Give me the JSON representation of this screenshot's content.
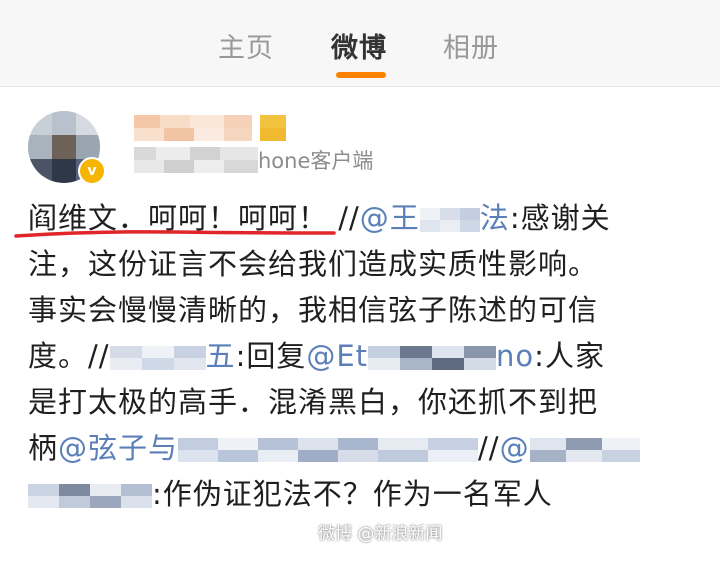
{
  "tabs": {
    "home": "主页",
    "weibo": "微博",
    "album": "相册"
  },
  "post": {
    "client_suffix": "hone客户端",
    "line1_highlight": "阎维文．呵呵！呵呵！",
    "line1_sep": "//",
    "line1_at": "@王",
    "line1_at_tail": "法",
    "line1_rest": ":感谢关",
    "line2": "注，这份证言不会给我们造成实质性影响。",
    "line3": "事实会慢慢清晰的，我相信弦子陈述的可信",
    "line4_start": "度。//",
    "line4_mid": "五",
    "line4_reply": ":回复",
    "line4_at": "@Et",
    "line4_at_tail": "no",
    "line4_end": ":人家",
    "line5": "是打太极的高手．混淆黑白，你还抓不到把",
    "line6_start": "柄",
    "line6_at": "@弦子与",
    "line6_end": "//",
    "line6_at2": "@",
    "line7_end": ":作伪证犯法不？作为一名军人"
  },
  "watermark": "微博 @新浪新闻",
  "colors": {
    "accent": "#ff8200",
    "link": "#5b7fb8",
    "underline": "#e0262b"
  }
}
